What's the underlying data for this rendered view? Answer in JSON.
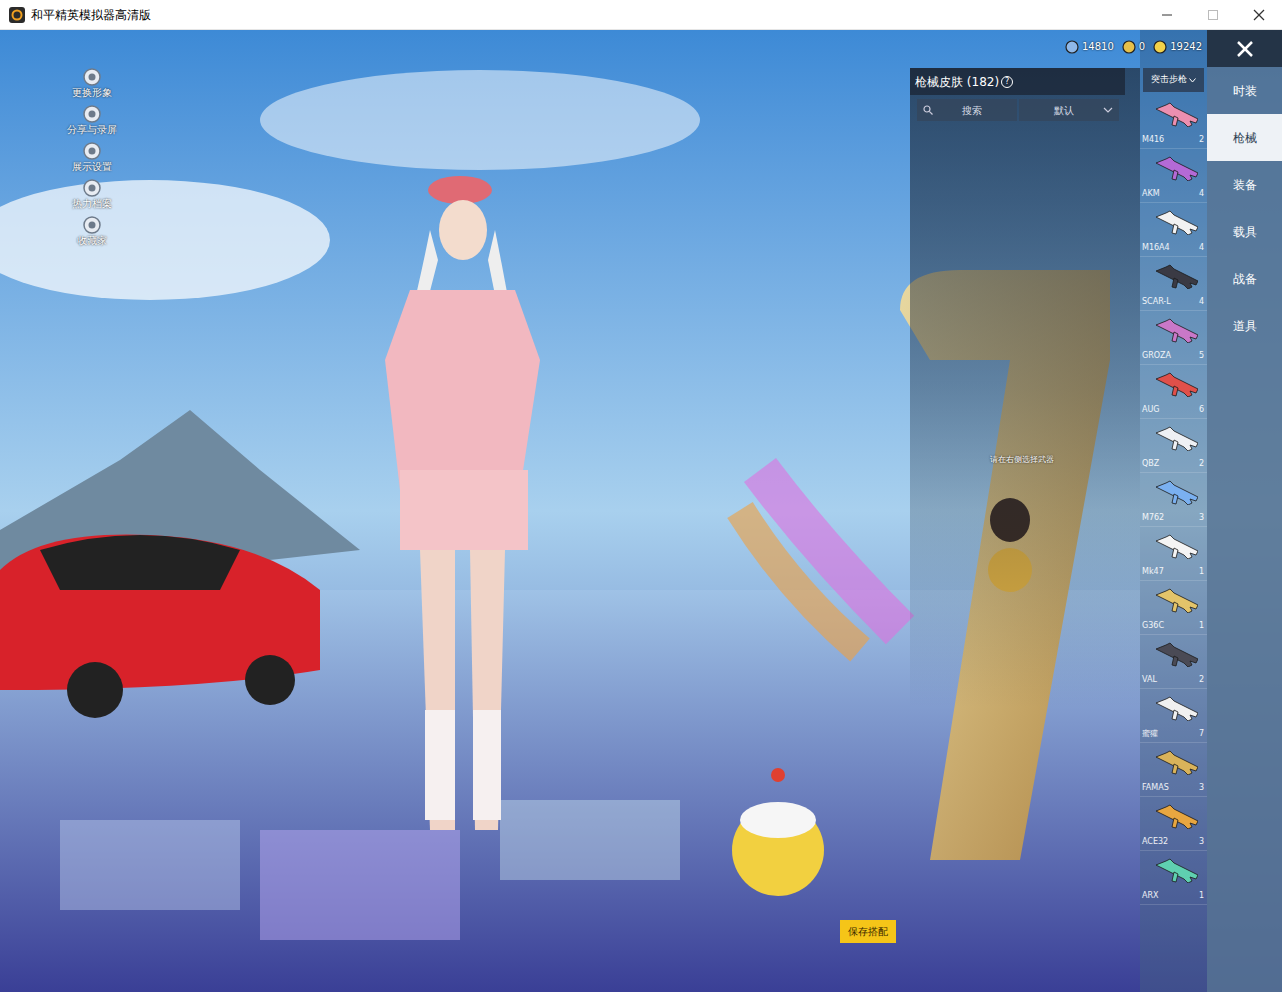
{
  "window": {
    "title": "和平精英模拟器高清版"
  },
  "side_menu": [
    {
      "label": "更换形象"
    },
    {
      "label": "分享与录屏"
    },
    {
      "label": "展示设置"
    },
    {
      "label": "热力档案"
    },
    {
      "label": "收藏家"
    }
  ],
  "currencies": [
    {
      "amount": "14810",
      "color": "#8fb8e8"
    },
    {
      "amount": "0",
      "color": "#e6c04a"
    },
    {
      "amount": "19242",
      "color": "#f2d24a"
    }
  ],
  "nav": {
    "items": [
      {
        "label": "时装",
        "selected": false
      },
      {
        "label": "枪械",
        "selected": true
      },
      {
        "label": "装备",
        "selected": false
      },
      {
        "label": "载具",
        "selected": false
      },
      {
        "label": "战备",
        "selected": false
      },
      {
        "label": "道具",
        "selected": false
      }
    ]
  },
  "skin_panel": {
    "title": "枪械皮肤 (182)",
    "help": "?",
    "search": "搜索",
    "sort": "默认",
    "hint": "请在右侧选择武器"
  },
  "category": {
    "label": "突击步枪"
  },
  "guns": [
    {
      "name": "M416",
      "count": "2",
      "color": "#ec8fb0"
    },
    {
      "name": "AKM",
      "count": "4",
      "color": "#b46ad6"
    },
    {
      "name": "M16A4",
      "count": "4",
      "color": "#f2f2f2"
    },
    {
      "name": "SCAR-L",
      "count": "4",
      "color": "#3a3a44"
    },
    {
      "name": "GROZA",
      "count": "5",
      "color": "#c978c8"
    },
    {
      "name": "AUG",
      "count": "6",
      "color": "#e0504a"
    },
    {
      "name": "QBZ",
      "count": "2",
      "color": "#eef0f4"
    },
    {
      "name": "M762",
      "count": "3",
      "color": "#7ab0f0"
    },
    {
      "name": "Mk47",
      "count": "1",
      "color": "#f4f4f4"
    },
    {
      "name": "G36C",
      "count": "1",
      "color": "#e3c46a"
    },
    {
      "name": "VAL",
      "count": "2",
      "color": "#4a4a55"
    },
    {
      "name": "蜜獾",
      "count": "7",
      "color": "#f0f0f0"
    },
    {
      "name": "FAMAS",
      "count": "3",
      "color": "#d9b35a"
    },
    {
      "name": "ACE32",
      "count": "3",
      "color": "#e8a640"
    },
    {
      "name": "ARX",
      "count": "1",
      "color": "#5fd0b0"
    }
  ],
  "save_button": "保存搭配"
}
